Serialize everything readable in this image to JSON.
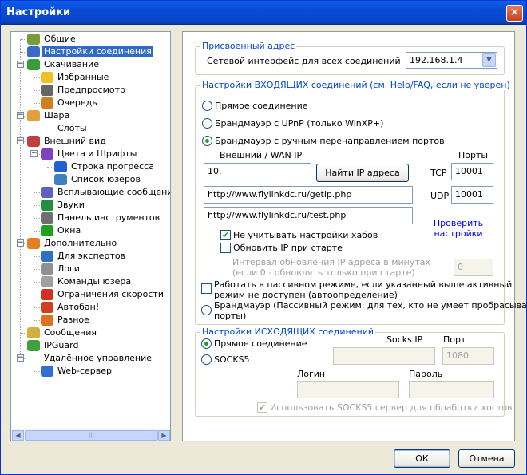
{
  "window": {
    "title": "Настройки",
    "close": "✕"
  },
  "tree": [
    {
      "label": "Общие",
      "icon": "users-icon",
      "depth": 1,
      "expander": ""
    },
    {
      "label": "Настройки соединения",
      "icon": "network-icon",
      "depth": 1,
      "expander": "",
      "selected": true
    },
    {
      "label": "Скачивание",
      "icon": "download-globe-icon",
      "depth": 1,
      "expander": "−"
    },
    {
      "label": "Избранные",
      "icon": "star-icon",
      "depth": 2,
      "expander": ""
    },
    {
      "label": "Предпросмотр",
      "icon": "preview-icon",
      "depth": 2,
      "expander": ""
    },
    {
      "label": "Очередь",
      "icon": "queue-icon",
      "depth": 2,
      "expander": ""
    },
    {
      "label": "Шара",
      "icon": "share-hand-icon",
      "depth": 1,
      "expander": "−"
    },
    {
      "label": "Слоты",
      "icon": "",
      "depth": 2,
      "expander": ""
    },
    {
      "label": "Внешний вид",
      "icon": "appearance-icon",
      "depth": 1,
      "expander": "−"
    },
    {
      "label": "Цвета и Шрифты",
      "icon": "colors-icon",
      "depth": 2,
      "expander": "−"
    },
    {
      "label": "Строка прогресса",
      "icon": "progress-icon",
      "depth": 3,
      "expander": ""
    },
    {
      "label": "Список юзеров",
      "icon": "userlist-icon",
      "depth": 3,
      "expander": ""
    },
    {
      "label": "Всплывающие сообщения",
      "icon": "popup-icon",
      "depth": 2,
      "expander": ""
    },
    {
      "label": "Звуки",
      "icon": "music-icon",
      "depth": 2,
      "expander": ""
    },
    {
      "label": "Панель инструментов",
      "icon": "tools-icon",
      "depth": 2,
      "expander": ""
    },
    {
      "label": "Окна",
      "icon": "windows-icon",
      "depth": 2,
      "expander": ""
    },
    {
      "label": "Дополнительно",
      "icon": "advanced-icon",
      "depth": 1,
      "expander": "−"
    },
    {
      "label": "Для экспертов",
      "icon": "expert-icon",
      "depth": 2,
      "expander": ""
    },
    {
      "label": "Логи",
      "icon": "logs-icon",
      "depth": 2,
      "expander": ""
    },
    {
      "label": "Команды юзера",
      "icon": "commands-icon",
      "depth": 2,
      "expander": ""
    },
    {
      "label": "Ограничения скорости",
      "icon": "speed-limit-icon",
      "depth": 2,
      "expander": ""
    },
    {
      "label": "Автобан!",
      "icon": "autoban-icon",
      "depth": 2,
      "expander": ""
    },
    {
      "label": "Разное",
      "icon": "misc-icon",
      "depth": 2,
      "expander": ""
    },
    {
      "label": "Сообщения",
      "icon": "messages-icon",
      "depth": 1,
      "expander": ""
    },
    {
      "label": "IPGuard",
      "icon": "ipguard-icon",
      "depth": 1,
      "expander": ""
    },
    {
      "label": "Удалённое управление",
      "icon": "",
      "depth": 1,
      "expander": "−"
    },
    {
      "label": "Web-сервер",
      "icon": "globe-icon",
      "depth": 2,
      "expander": ""
    }
  ],
  "assigned": {
    "title": "Присвоенный адрес",
    "label": "Сетевой интерфейс для всех соединений",
    "value": "192.168.1.4"
  },
  "incoming": {
    "title": "Настройки ВХОДЯЩИХ соединений (см. Help/FAQ, если не уверен)",
    "direct": "Прямое соединение",
    "upnp": "Брандмауэр с UPnP (только WinXP+)",
    "manual": "Брандмауэр с ручным перенаправлением портов",
    "wan_label": "Внешний / WAN IP",
    "ports_label": "Порты",
    "wan_value": "10.",
    "find_button": "Найти IP адреса",
    "tcp_label": "TCP",
    "tcp_value": "10001",
    "udp_label": "UDP",
    "udp_value": "10001",
    "url1": "http://www.flylinkdc.ru/getip.php",
    "url2": "http://www.flylinkdc.ru/test.php",
    "check_link": "Проверить настройки",
    "ignore_hubs": "Не учитывать настройки хабов",
    "update_ip": "Обновить IP при старте",
    "interval_label": "Интервал обновления IP адреса в минутах",
    "interval_hint": "(если 0 - обновлять только при старте)",
    "interval_value": "0",
    "passive_check": "Работать в пассивном режиме, если указанный выше активный",
    "passive_check2": "режим не доступен (автоопределение)",
    "firewall_passive": "Брандмауэр (Пассивный режим: для тех, кто не умеет пробрасывать",
    "firewall_passive2": "порты)"
  },
  "outgoing": {
    "title": "Настройки ИСХОДЯЩИХ соединений",
    "direct": "Прямое соединение",
    "socks5": "SOCKS5",
    "socks_ip": "Socks IP",
    "port_label": "Порт",
    "port_value": "1080",
    "login_label": "Логин",
    "password_label": "Пароль",
    "use_socks": "Использовать SOCKS5 сервер для обработки хостов"
  },
  "buttons": {
    "ok": "ОК",
    "cancel": "Отмена"
  }
}
